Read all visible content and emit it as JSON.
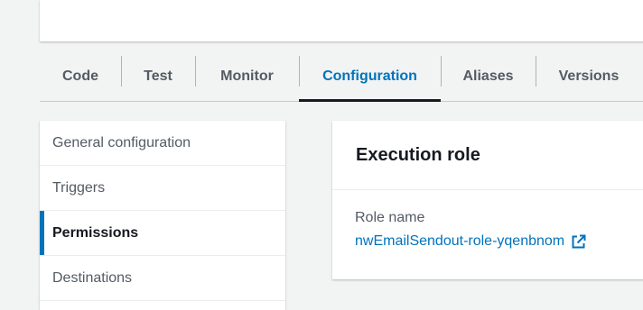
{
  "tabs": [
    {
      "label": "Code",
      "width": 90
    },
    {
      "label": "Test",
      "width": 82
    },
    {
      "label": "Monitor",
      "width": 115
    },
    {
      "label": "Configuration",
      "width": 157,
      "active": true
    },
    {
      "label": "Aliases",
      "width": 105
    },
    {
      "label": "Versions",
      "width": 118
    }
  ],
  "side_nav": {
    "items": [
      {
        "label": "General configuration"
      },
      {
        "label": "Triggers"
      },
      {
        "label": "Permissions",
        "active": true
      },
      {
        "label": "Destinations"
      }
    ]
  },
  "execution_role": {
    "title": "Execution role",
    "role_name_label": "Role name",
    "role_name_value": "nwEmailSendout-role-yqenbnom",
    "link_icon": "external-link-icon"
  },
  "colors": {
    "accent": "#0073bb",
    "background": "#f2f3f3",
    "text": "#16191f",
    "muted": "#545b64"
  }
}
